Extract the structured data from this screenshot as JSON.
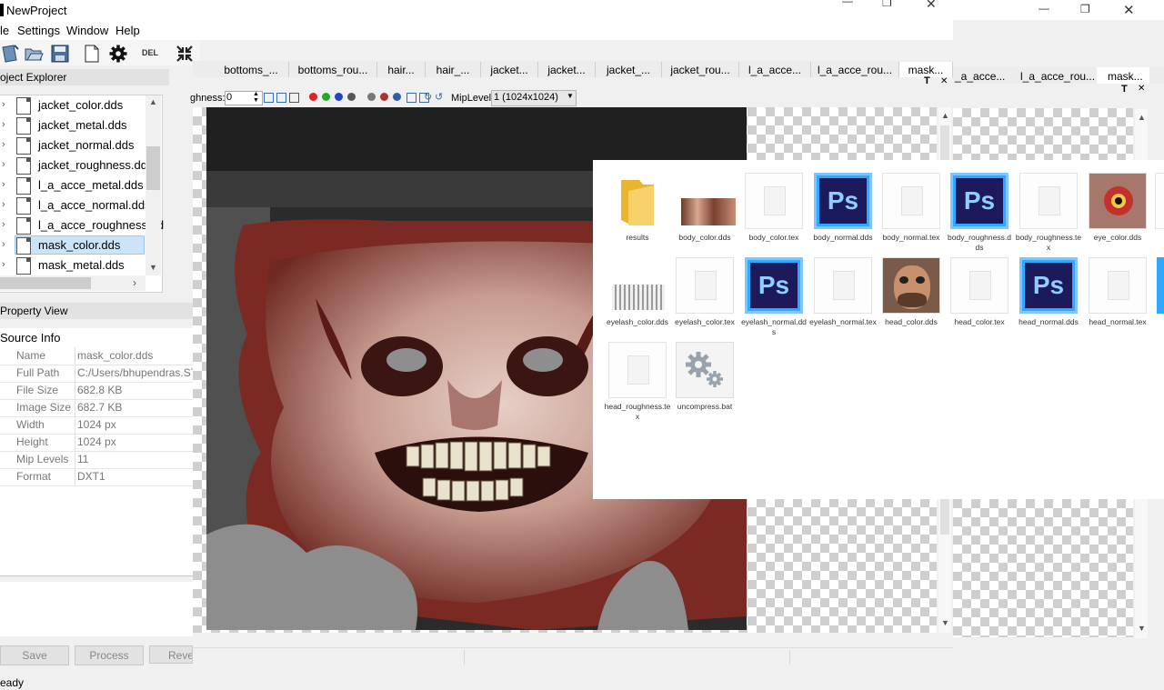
{
  "app": {
    "title": "NewProject",
    "status": "eady"
  },
  "menu": [
    "le",
    "Settings",
    "Window",
    "Help"
  ],
  "toolbar": {
    "del_label": "DEL"
  },
  "window_controls": {
    "minimize": "—",
    "maximize": "❐",
    "close": "✕"
  },
  "tabs": [
    "bottoms_...",
    "bottoms_rou...",
    "hair...",
    "hair_...",
    "jacket...",
    "jacket...",
    "jacket_...",
    "jacket_rou...",
    "l_a_acce...",
    "l_a_acce_rou...",
    "mask..."
  ],
  "back_tabs": [
    "_a_acce...",
    "l_a_acce_rou...",
    "mask..."
  ],
  "project_explorer": {
    "title": "oject Explorer",
    "items": [
      "jacket_color.dds",
      "jacket_metal.dds",
      "jacket_normal.dds",
      "jacket_roughness.dds",
      "l_a_acce_metal.dds",
      "l_a_acce_normal.dds",
      "l_a_acce_roughness.dd",
      "mask_color.dds",
      "mask_metal.dds"
    ],
    "selected_index": 7
  },
  "property_view": {
    "title": "Property View",
    "section": "Source Info",
    "rows": [
      {
        "k": "Name",
        "v": "mask_color.dds"
      },
      {
        "k": "Full Path",
        "v": "C:/Users/bhupendras.ST"
      },
      {
        "k": "File Size",
        "v": "682.8 KB"
      },
      {
        "k": "Image Size",
        "v": "682.7 KB"
      },
      {
        "k": "Width",
        "v": "1024 px"
      },
      {
        "k": "Height",
        "v": "1024 px"
      },
      {
        "k": "Mip Levels",
        "v": "11"
      },
      {
        "k": "Format",
        "v": "DXT1"
      }
    ]
  },
  "buttons": {
    "save": "Save",
    "process": "Process",
    "revert": "Rever"
  },
  "viewer": {
    "roughness_label": "ghness:",
    "roughness_value": "0",
    "mip_label": "MipLevel:",
    "mip_value": "1 (1024x1024)",
    "pin_label": "T",
    "close_label": "✕"
  },
  "explorer": {
    "items": [
      {
        "name": "results",
        "icon": "folder-icon"
      },
      {
        "name": "body_color.dds",
        "icon": "texture-thumb"
      },
      {
        "name": "body_color.tex",
        "icon": "document-icon"
      },
      {
        "name": "body_normal.dds",
        "icon": "photoshop-icon"
      },
      {
        "name": "body_normal.tex",
        "icon": "document-icon"
      },
      {
        "name": "body_roughness.dds",
        "icon": "photoshop-icon"
      },
      {
        "name": "body_roughness.tex",
        "icon": "document-icon"
      },
      {
        "name": "eye_color.dds",
        "icon": "eye-thumb"
      },
      {
        "name": "eyelash_color.dds",
        "icon": "eyelash-thumb"
      },
      {
        "name": "eyelash_color.tex",
        "icon": "document-icon"
      },
      {
        "name": "eyelash_normal.dds",
        "icon": "photoshop-icon"
      },
      {
        "name": "eyelash_normal.tex",
        "icon": "document-icon"
      },
      {
        "name": "head_color.dds",
        "icon": "face-thumb"
      },
      {
        "name": "head_color.tex",
        "icon": "document-icon"
      },
      {
        "name": "head_normal.dds",
        "icon": "photoshop-icon"
      },
      {
        "name": "head_normal.tex",
        "icon": "document-icon"
      },
      {
        "name": "head_roughness.tex",
        "icon": "document-icon"
      },
      {
        "name": "uncompress.bat",
        "icon": "gear-file-icon"
      }
    ],
    "ps_text": "Ps"
  },
  "colors": {
    "selection": "#cce4f7",
    "ps_bg": "#1d1a5c",
    "ps_border": "#31a8ff",
    "folder": "#f7c948"
  }
}
